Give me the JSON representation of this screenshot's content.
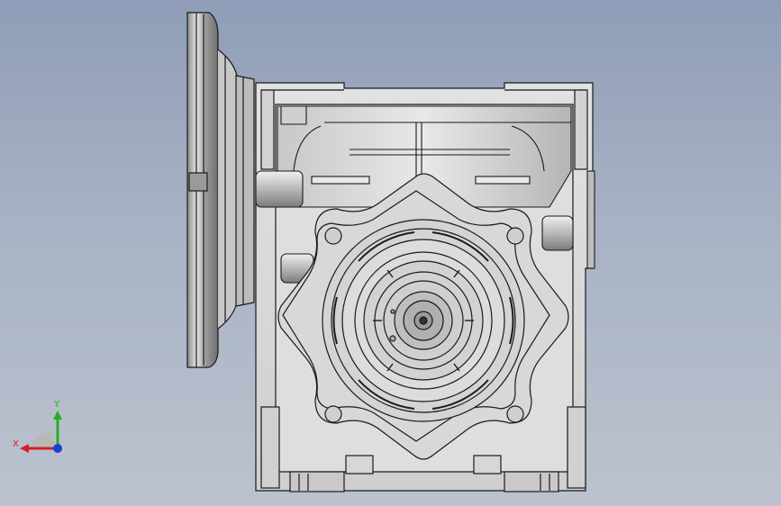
{
  "viewport": {
    "background_top": "#8f9db8",
    "background_bottom": "#bcc3cf"
  },
  "model": {
    "body_color": "#d9d9d9",
    "edge_color": "#1a1a1a",
    "shade_color": "#a9a9a9"
  },
  "triad": {
    "x_label": "X",
    "y_label": "Y",
    "x_color": "#d42020",
    "y_color": "#22b022",
    "z_color": "#1a3fd6"
  }
}
